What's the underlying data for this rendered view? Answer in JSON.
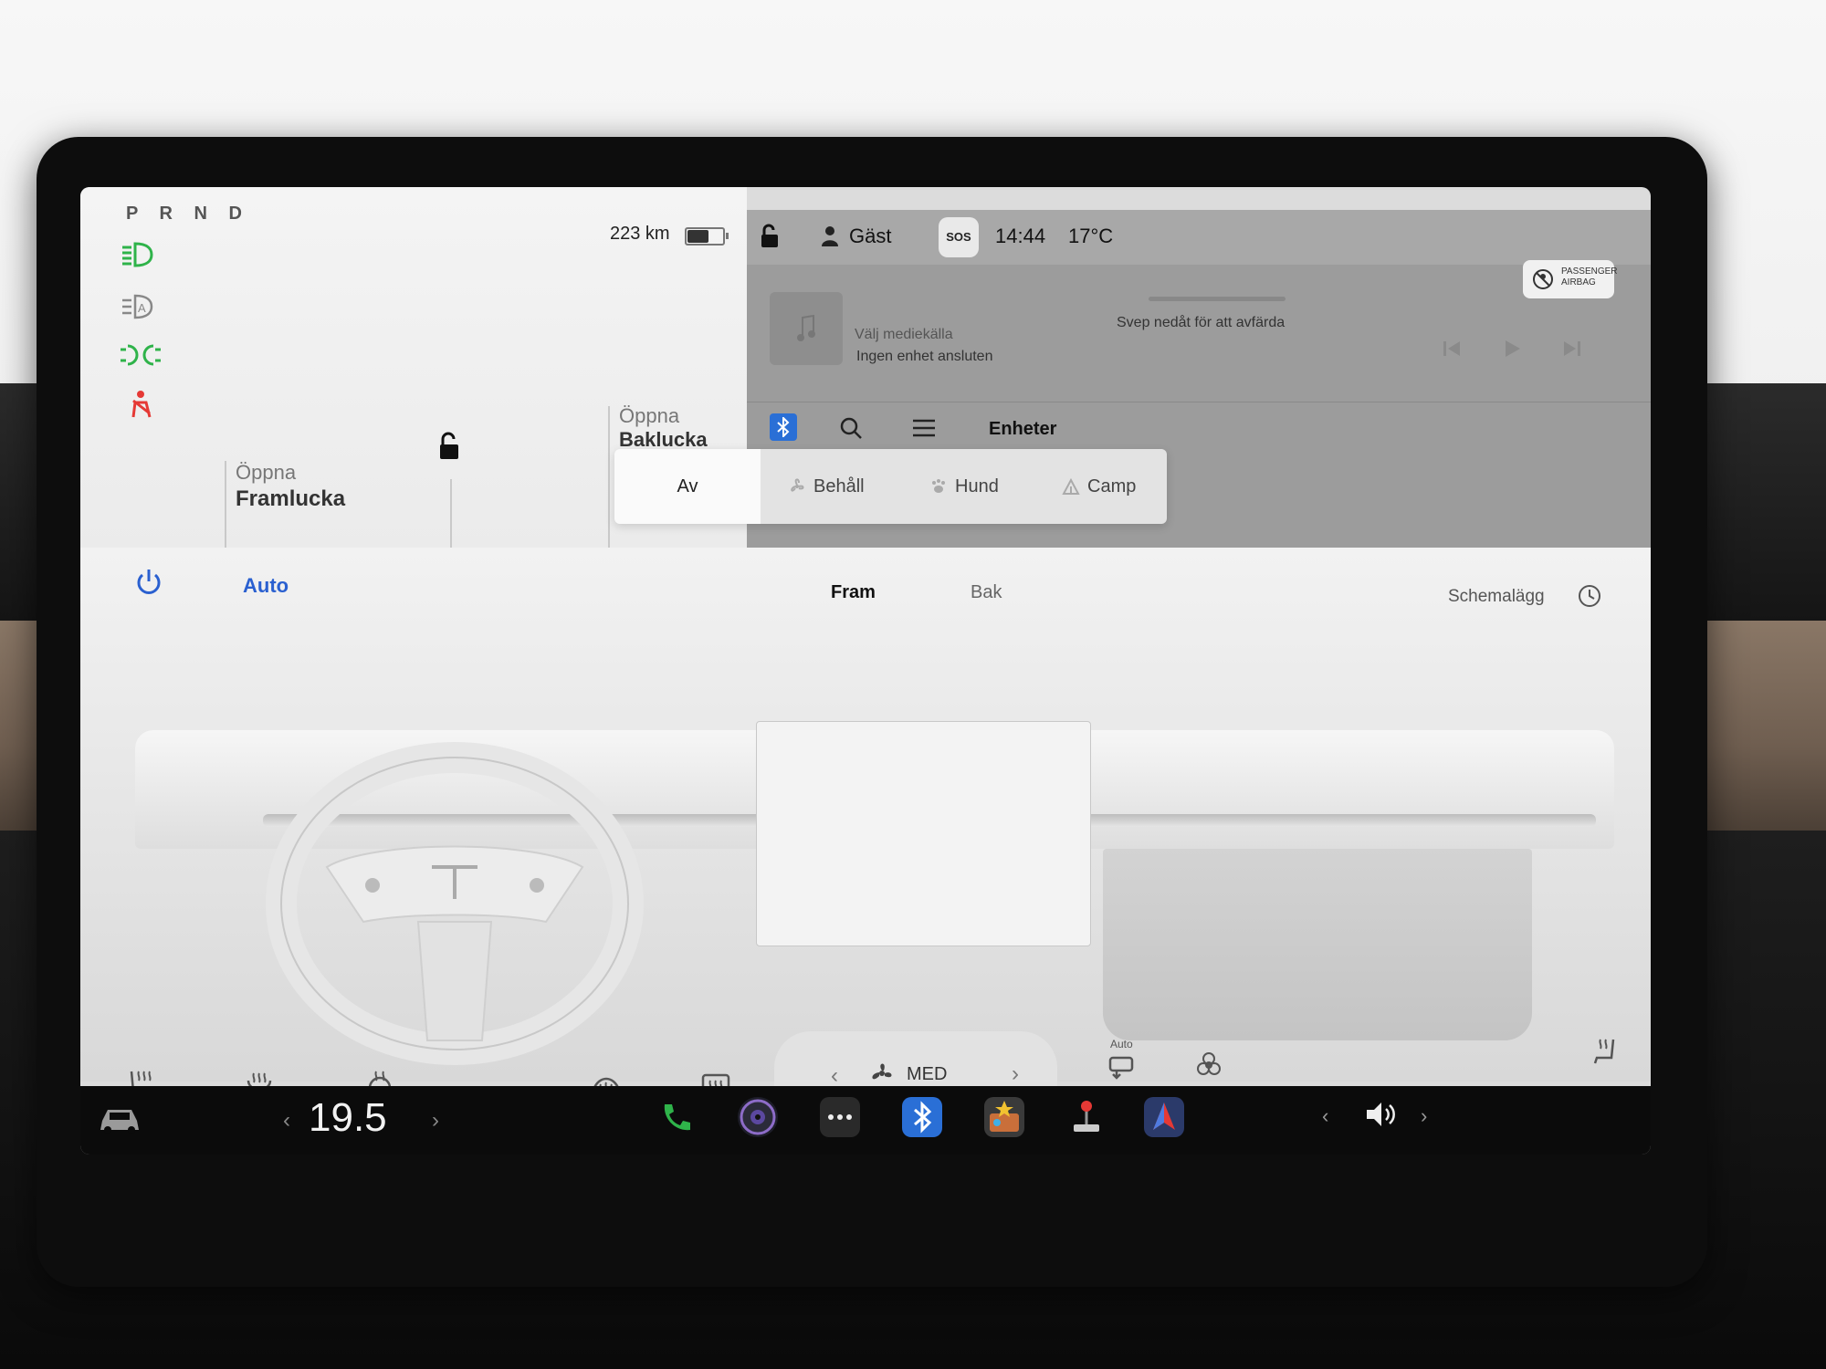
{
  "gear": "P R N D",
  "range": "223 km",
  "battery_level": 0.65,
  "telltales": [
    "headlights-icon",
    "auto-highbeam-icon",
    "parking-lights-icon",
    "seatbelt-warning-icon"
  ],
  "frunk": {
    "line1": "Öppna",
    "line2": "Framlucka"
  },
  "trunk": {
    "line1": "Öppna",
    "line2": "Baklucka"
  },
  "status": {
    "profile": "Gäst",
    "sos": "SOS",
    "time": "14:44",
    "outside_temp": "17°C"
  },
  "airbag": {
    "line1": "PASSENGER",
    "line2": "AIRBAG"
  },
  "media": {
    "swipe_hint": "Svep nedåt för att avfärda",
    "source": "Välj mediekälla",
    "device": "Ingen enhet ansluten",
    "tab_devices": "Enheter"
  },
  "modes": [
    {
      "label": "Av",
      "icon": ""
    },
    {
      "label": "Behåll",
      "icon": "fan-icon"
    },
    {
      "label": "Hund",
      "icon": "paw-icon"
    },
    {
      "label": "Camp",
      "icon": "tent-icon"
    }
  ],
  "climate": {
    "auto": "Auto",
    "tab_front": "Fram",
    "tab_rear": "Bak",
    "schedule": "Schemalägg",
    "fan_level": "MED",
    "recirc_mode": "Auto"
  },
  "dock": {
    "temperature": "19.5",
    "apps": [
      "phone-icon",
      "camera-icon",
      "more-icon",
      "bluetooth-icon",
      "toybox-icon",
      "arcade-icon",
      "navigation-icon"
    ]
  },
  "colors": {
    "accent": "#2a60d0",
    "telltale_green": "#2fb34a",
    "telltale_red": "#e53935",
    "bluetooth": "#2a6fd6"
  }
}
